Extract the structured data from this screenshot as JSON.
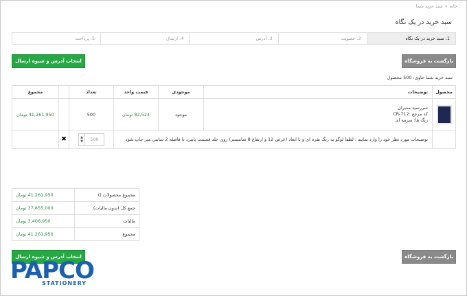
{
  "breadcrumb": {
    "home": "خانه",
    "separator": "»",
    "current": "سبد خرید شما"
  },
  "page_title": "سبد خرید در یک نگاه",
  "steps": [
    {
      "label": "1. سبد خرید در یک نگاه",
      "active": true
    },
    {
      "label": "2. عضویت",
      "active": false
    },
    {
      "label": "3. آدرس",
      "active": false
    },
    {
      "label": "4. ارسال",
      "active": false
    },
    {
      "label": "5. پرداخت",
      "active": false
    }
  ],
  "actions": {
    "back_to_shop": "بازگشت به فروشگاه",
    "choose_shipping": "انتخاب آدرس و شیوه ارسال"
  },
  "cart_summary": "سبد خرید شما حاوی: 500 محصول",
  "table": {
    "headers": {
      "product": "محصول",
      "description": "توضیحات",
      "availability": "موجودی",
      "unit_price": "قیمت واحد",
      "quantity": "تعداد",
      "total": "مجموع"
    },
    "row": {
      "name": "سررسید مدیران",
      "ref": "کد مرجع :CR-712",
      "color": "رنگ ها: سرمه ای",
      "availability": "موجود",
      "unit_price": "82,524 تومان",
      "quantity": "500",
      "total": "41,261,950 تومان"
    },
    "note": "توضیحات مورد نظر خود را وارد نمایید : لطفا لوگو به رنگ نقره ای و با ابعاد (عرض 12 و ارتفاع 8 سانتیمتر) روی جلد قسمت پایین، با فاصله 2 سانتی متر چاپ شود",
    "qty_input_value": "500",
    "remove_symbol": "✖"
  },
  "totals": [
    {
      "label": "مجموع محصولات ()",
      "value": "41,261,950 تومان"
    },
    {
      "label": "جمع کل (بدون مالیات)",
      "value": "37,855,000 تومان"
    },
    {
      "label": "مالیات",
      "value": "3,406,950 تومان"
    },
    {
      "label": "مجموع",
      "value": "41,261,950 تومان"
    }
  ],
  "logo": {
    "main": "PAPCO",
    "sub": "STATIONERY"
  },
  "colors": {
    "accent_green": "#27a845",
    "button_gray": "#8a8a8a",
    "brand_blue": "#1a5fb0"
  }
}
